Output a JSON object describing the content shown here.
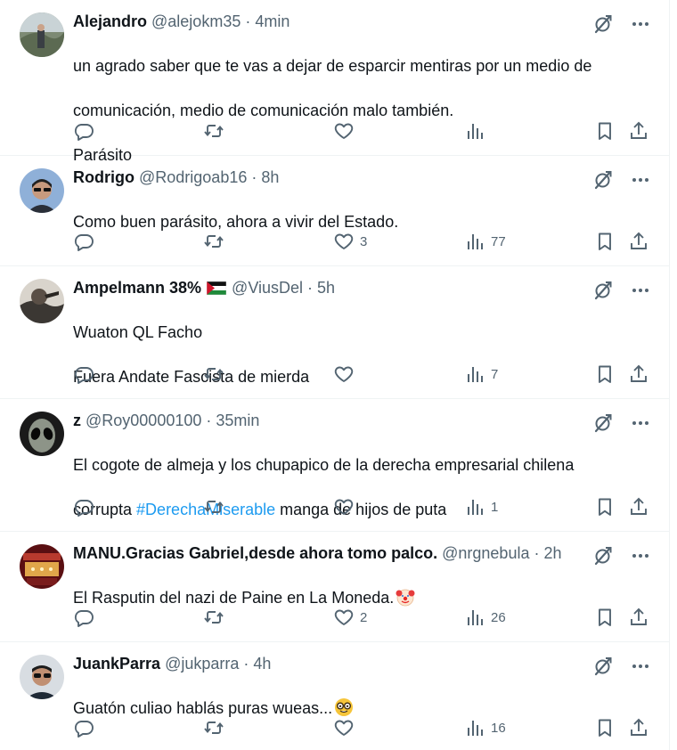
{
  "tweets": [
    {
      "name": "Alejandro",
      "handle": "@alejokm35",
      "time": "4min",
      "lines": [
        "un agrado saber que te vas a dejar de esparcir mentiras por un medio de",
        "comunicación, medio de comunicación malo también.",
        "Parásito"
      ],
      "likes": "",
      "views": ""
    },
    {
      "name": "Rodrigo",
      "handle": "@Rodrigoab16",
      "time": "8h",
      "lines": [
        "Como buen parásito, ahora a vivir del Estado."
      ],
      "likes": "3",
      "views": "77"
    },
    {
      "name": "Ampelmann 38%",
      "handle": "@ViusDel",
      "time": "5h",
      "lines": [
        "Wuaton QL Facho",
        "Fuera Andate Fascista de mierda"
      ],
      "likes": "",
      "views": "7"
    },
    {
      "name": "z",
      "handle": "@Roy00000100",
      "time": "35min",
      "line1": "El cogote de almeja y los chupapico de la derecha empresarial chilena",
      "line2_pre": "corrupta ",
      "hashtag": "#DerechaMiserable",
      "line2_post": " manga de hijos de puta",
      "likes": "",
      "views": "1"
    },
    {
      "name": "MANU.Gracias Gabriel,desde ahora tomo palco.",
      "handle": "@nrgnebula",
      "time": "2h",
      "text": "El Rasputin del nazi de Paine en La Moneda.",
      "emoji": "clown-face",
      "likes": "2",
      "views": "26"
    },
    {
      "name": "JuankParra",
      "handle": "@jukparra",
      "time": "4h",
      "text": "Guatón culiao hablás puras wueas...",
      "emoji": "nerd-face",
      "likes": "",
      "views": "16"
    }
  ],
  "separator": "·",
  "colors": {
    "text": "#0f1419",
    "secondary": "#536471",
    "link": "#1d9bf0",
    "border": "#eff3f4"
  },
  "icons": [
    "grok-icon",
    "more-icon",
    "reply-icon",
    "retweet-icon",
    "like-icon",
    "views-icon",
    "bookmark-icon",
    "share-icon"
  ]
}
